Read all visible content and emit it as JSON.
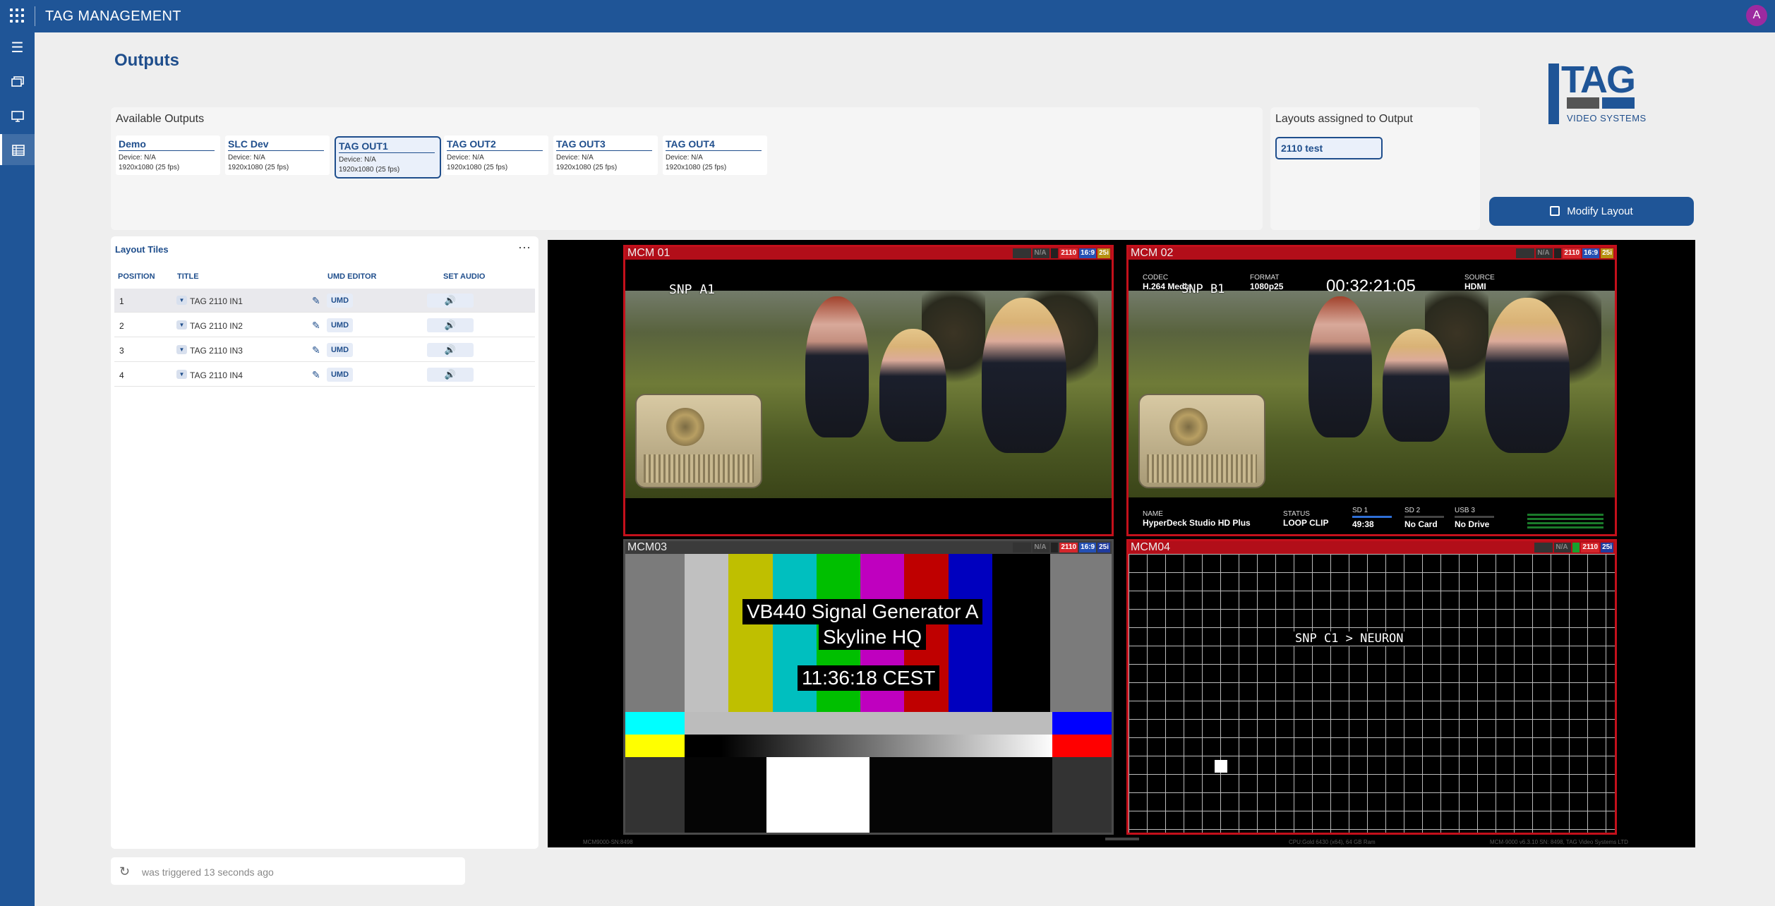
{
  "app": {
    "title": "TAG MANAGEMENT",
    "avatar": "A"
  },
  "nav": {
    "items": [
      "menu-icon",
      "monitors-icon",
      "screen-icon",
      "table-icon"
    ],
    "active": "table-icon"
  },
  "page": {
    "title": "Outputs"
  },
  "logo": {
    "text": "TAG",
    "subtitle": "VIDEO SYSTEMS"
  },
  "outputs": {
    "header": "Available Outputs",
    "items": [
      {
        "name": "Demo",
        "device": "Device: N/A",
        "resolution": "1920x1080 (25 fps)",
        "selected": false
      },
      {
        "name": "SLC Dev",
        "device": "Device: N/A",
        "resolution": "1920x1080 (25 fps)",
        "selected": false
      },
      {
        "name": "TAG OUT1",
        "device": "Device: N/A",
        "resolution": "1920x1080 (25 fps)",
        "selected": true
      },
      {
        "name": "TAG OUT2",
        "device": "Device: N/A",
        "resolution": "1920x1080 (25 fps)",
        "selected": false
      },
      {
        "name": "TAG OUT3",
        "device": "Device: N/A",
        "resolution": "1920x1080 (25 fps)",
        "selected": false
      },
      {
        "name": "TAG OUT4",
        "device": "Device: N/A",
        "resolution": "1920x1080 (25 fps)",
        "selected": false
      }
    ]
  },
  "assigned": {
    "header": "Layouts assigned to Output",
    "layout": "2110 test"
  },
  "modify_button": {
    "label": "Modify Layout",
    "color": "#1f5597"
  },
  "tiles": {
    "title": "Layout Tiles",
    "menu": "⋯",
    "columns": [
      "POSITION",
      "TITLE",
      "UMD EDITOR",
      "SET AUDIO"
    ],
    "umd_label": "UMD",
    "rows": [
      {
        "position": "1",
        "title": "TAG 2110 IN1"
      },
      {
        "position": "2",
        "title": "TAG 2110 IN2"
      },
      {
        "position": "3",
        "title": "TAG 2110 IN3"
      },
      {
        "position": "4",
        "title": "TAG 2110 IN4"
      }
    ]
  },
  "status": {
    "text": "was triggered 13 seconds ago"
  },
  "multiviewer": {
    "tiles": [
      {
        "label": "MCM 01",
        "snp": "SNP A1",
        "badges": [
          "N/A",
          "2110",
          "16:9",
          "25i"
        ]
      },
      {
        "label": "MCM 02",
        "snp": "SNP B1",
        "badges": [
          "N/A",
          "2110",
          "16:9",
          "25i"
        ],
        "codec": {
          "label": "CODEC",
          "value": "H.264 Media"
        },
        "format": {
          "label": "FORMAT",
          "value": "1080p25"
        },
        "timecode": "00:32:21:05",
        "source": {
          "label": "SOURCE",
          "value": "HDMI"
        },
        "name": {
          "label": "NAME",
          "value": "HyperDeck Studio HD Plus"
        },
        "status_field": {
          "label": "STATUS",
          "value": "LOOP CLIP"
        },
        "sd1": {
          "label": "SD 1",
          "value": "49:38"
        },
        "sd2": {
          "label": "SD 2",
          "value": "No Card"
        },
        "usb": {
          "label": "USB 3",
          "value": "No Drive"
        }
      },
      {
        "label": "MCM03",
        "badges": [
          "N/A",
          "2110",
          "16:9",
          "25i"
        ],
        "line1": "VB440 Signal Generator A",
        "line2": "Skyline HQ",
        "clock": "11:36:18 CEST"
      },
      {
        "label": "MCM04",
        "snp": "SNP C1 > NEURON",
        "badges": [
          "N/A",
          "2110",
          "25i"
        ]
      }
    ],
    "footer": {
      "left": "MCM9000-SN:8498",
      "center": "CPU:Gold 6430 (x64), 64 GB Ram",
      "right": "MCM-9000 v6.3.10 SN: 8498, TAG Video Systems LTD"
    }
  },
  "colors": {
    "brand": "#1f5597",
    "alarm": "#c4101b"
  }
}
